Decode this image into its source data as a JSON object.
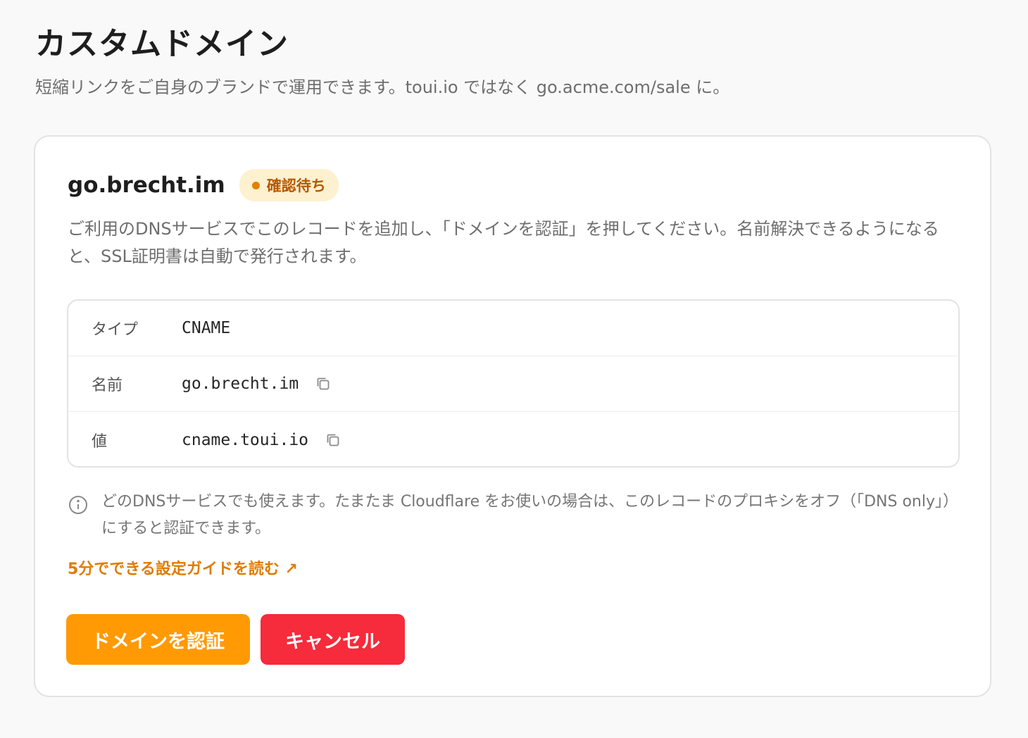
{
  "header": {
    "title": "カスタムドメイン",
    "subtitle": "短縮リンクをご自身のブランドで運用できます。toui.io ではなく go.acme.com/sale に。"
  },
  "card": {
    "domain": "go.brecht.im",
    "status": "確認待ち",
    "status_color": "#e28000",
    "instructions": "ご利用のDNSサービスでこのレコードを追加し、「ドメインを認証」を押してください。名前解決できるようになると、SSL証明書は自動で発行されます。",
    "records": {
      "type_label": "タイプ",
      "type_value": "CNAME",
      "name_label": "名前",
      "name_value": "go.brecht.im",
      "value_label": "値",
      "value_value": "cname.toui.io"
    },
    "note": "どのDNSサービスでも使えます。たまたま Cloudflare をお使いの場合は、このレコードのプロキシをオフ（「DNS only」）にすると認証できます。",
    "guide_link": "5分でできる設定ガイドを読む ↗",
    "verify_button": "ドメインを認証",
    "cancel_button": "キャンセル",
    "accent_color": "#ff9a05",
    "danger_color": "#f62b3b"
  }
}
